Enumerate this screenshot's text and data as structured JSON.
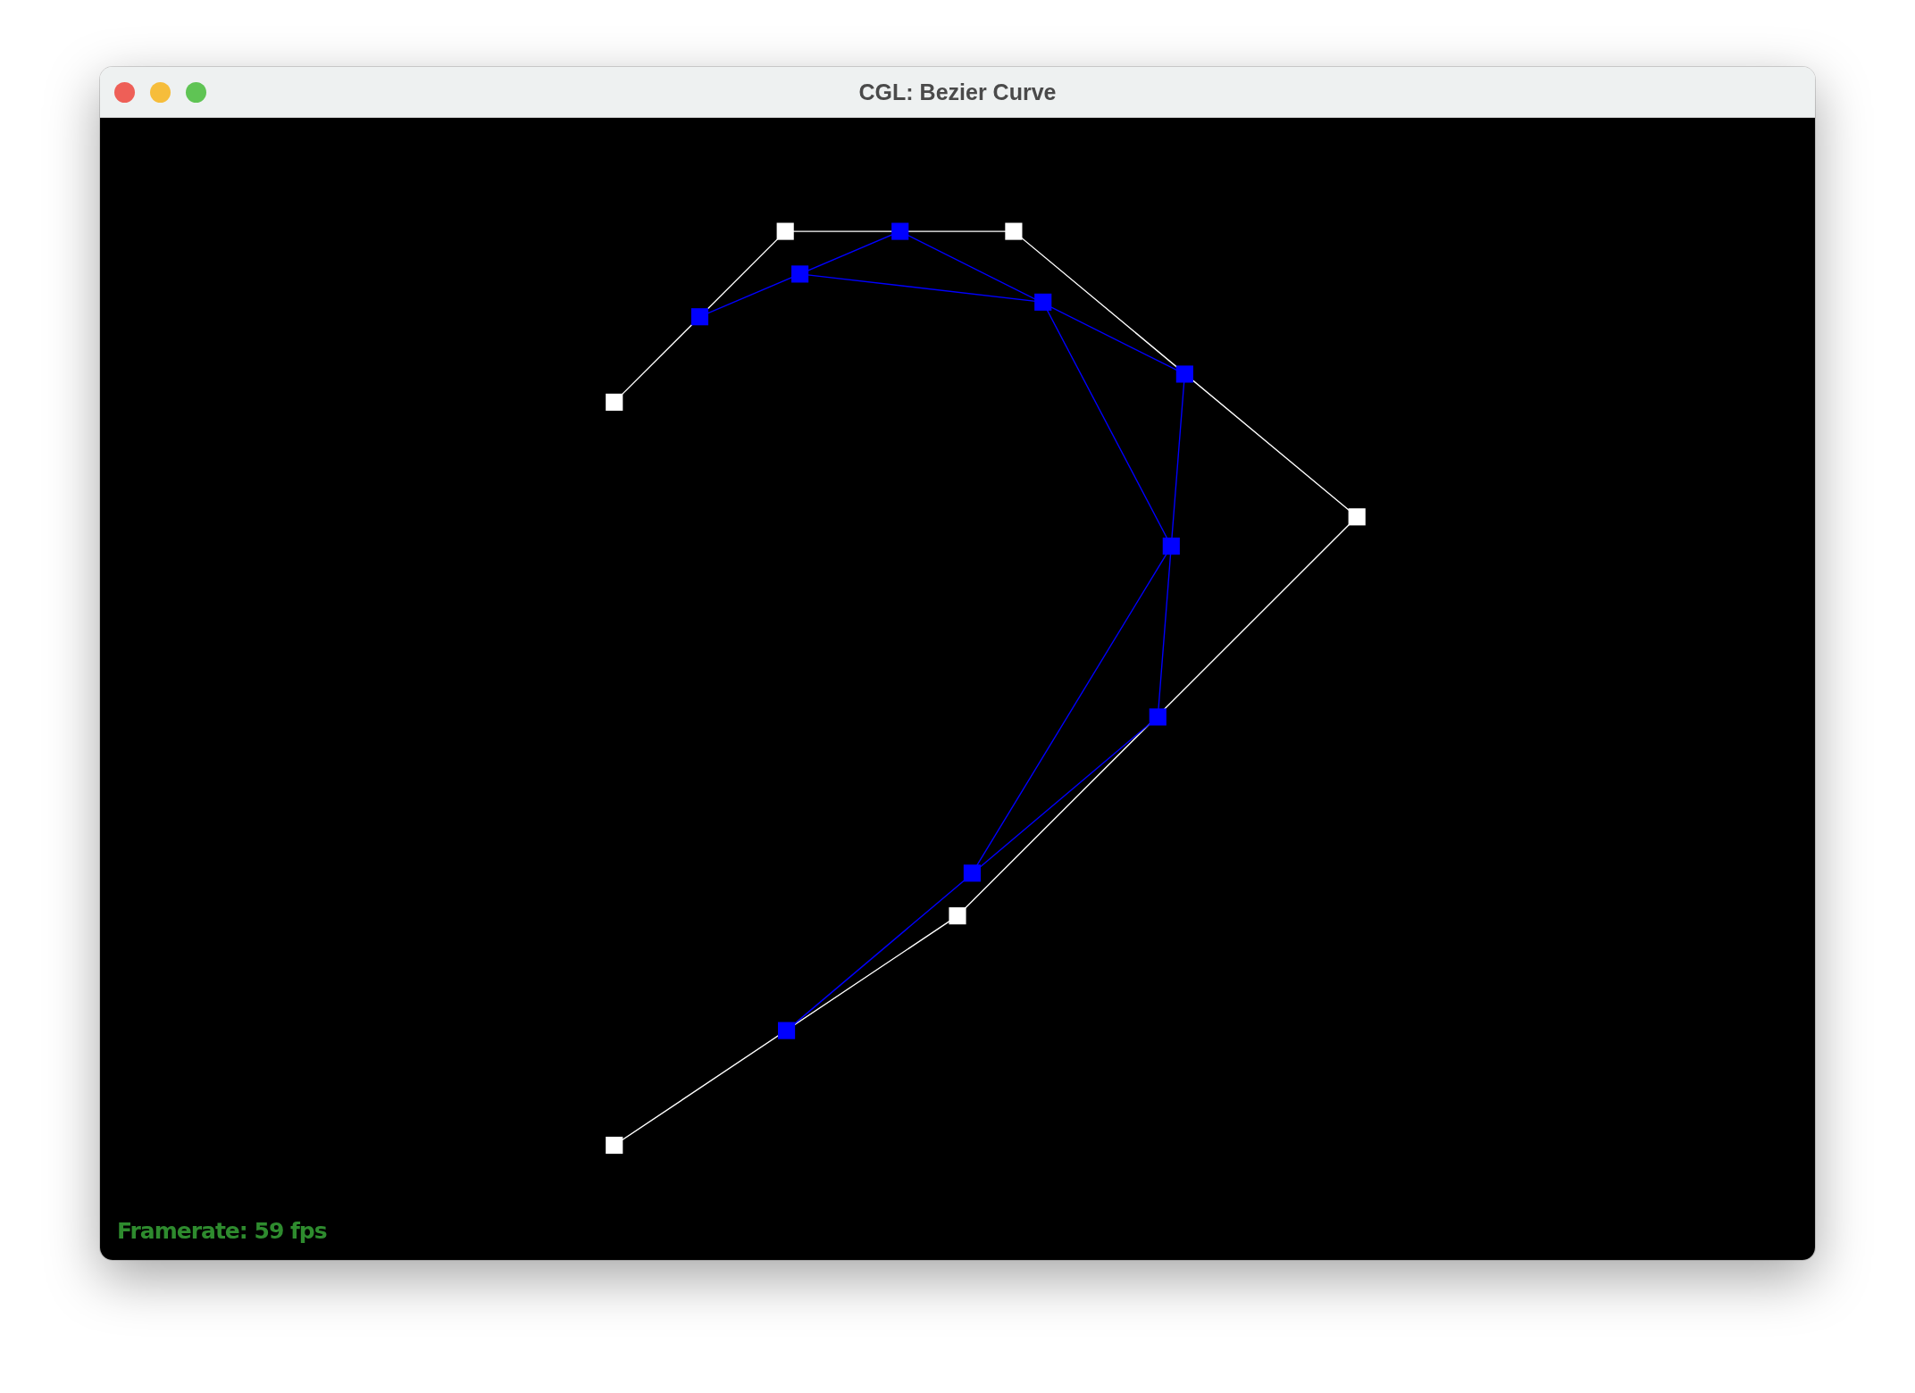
{
  "window": {
    "title": "CGL: Bezier Curve"
  },
  "canvas": {
    "framerate": "Framerate: 59 fps"
  }
}
